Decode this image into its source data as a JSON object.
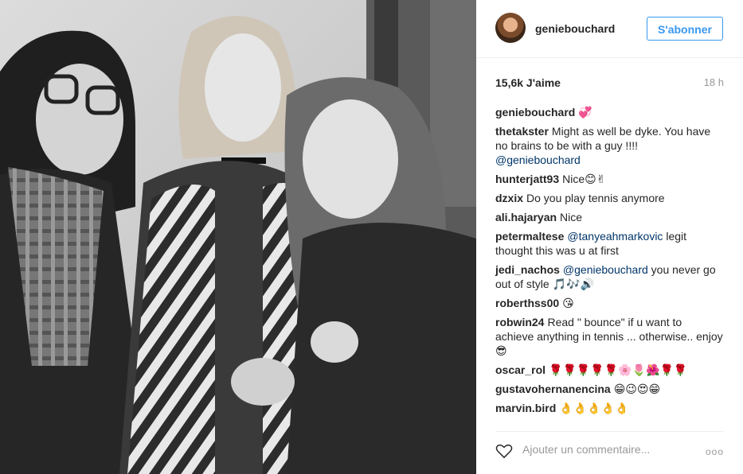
{
  "post": {
    "author": "geniebouchard",
    "follow_label": "S'abonner",
    "likes": "15,6k J'aime",
    "time_ago": "18 h",
    "caption_emoji": "💞",
    "image_icon": "photo-of-three-women-icon"
  },
  "comments": [
    {
      "user": "thetakster",
      "text": "Might as well be dyke. You have no brains to be with a guy !!!! ",
      "mention": "@geniebouchard",
      "after": ""
    },
    {
      "user": "hunterjatt93",
      "text": "Nice😊✌",
      "mention": "",
      "after": ""
    },
    {
      "user": "dzxix",
      "text": "Do you play tennis anymore",
      "mention": "",
      "after": ""
    },
    {
      "user": "ali.hajaryan",
      "text": "Nice",
      "mention": "",
      "after": ""
    },
    {
      "user": "petermaltese",
      "text": "",
      "mention": "@tanyeahmarkovic",
      "after": " legit thought this was u at first"
    },
    {
      "user": "jedi_nachos",
      "text": "",
      "mention": "@geniebouchard",
      "after": " you never go out of style 🎵🎶🔊"
    },
    {
      "user": "roberthss00",
      "text": "😘",
      "mention": "",
      "after": ""
    },
    {
      "user": "robwin24",
      "text": "Read \" bounce\" if u want to achieve anything in tennis ... otherwise.. enjoy 😎",
      "mention": "",
      "after": ""
    },
    {
      "user": "oscar_rol",
      "text": "🌹🌹🌹🌹🌹🌸🌷🌺🌹🌹",
      "mention": "",
      "after": ""
    },
    {
      "user": "gustavohernanencina",
      "text": "😁😉😍😁",
      "mention": "",
      "after": ""
    },
    {
      "user": "marvin.bird",
      "text": "👌👌👌👌👌",
      "mention": "",
      "after": ""
    }
  ],
  "footer": {
    "add_comment_placeholder": "Ajouter un commentaire...",
    "more_label": "ooo"
  }
}
